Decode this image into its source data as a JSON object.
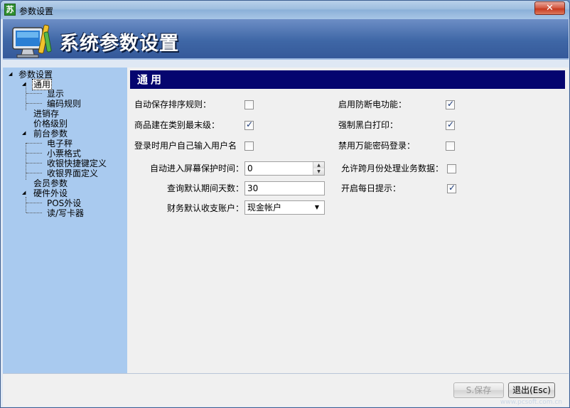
{
  "window": {
    "title": "参数设置",
    "app_icon_text": "苏",
    "close_label": "✕"
  },
  "banner": {
    "title": "系统参数设置",
    "logo_icon": "computer-settings-icon"
  },
  "tree": {
    "root": "参数设置",
    "general": "通用",
    "display": "显示",
    "code_rules": "编码规则",
    "purchase_sales_stock": "进销存",
    "price_levels": "价格级别",
    "front_desk": "前台参数",
    "electronic_scale": "电子秤",
    "receipt_format": "小票格式",
    "cashier_shortcuts": "收银快捷键定义",
    "cashier_ui": "收银界面定义",
    "member": "会员参数",
    "hardware": "硬件外设",
    "pos_peripherals": "POS外设",
    "card_reader": "读/写卡器"
  },
  "section": {
    "title": "通用"
  },
  "settings": {
    "auto_save_sort": {
      "label": "自动保存排序规则：",
      "checked": false
    },
    "power_off_protection": {
      "label": "启用防断电功能：",
      "checked": true
    },
    "goods_lowest_category": {
      "label": "商品建在类别最末级：",
      "checked": true
    },
    "force_bw_print": {
      "label": "强制黑白打印：",
      "checked": true
    },
    "login_enter_username": {
      "label": "登录时用户自己输入用户名",
      "checked": false
    },
    "disable_master_password": {
      "label": "禁用万能密码登录：",
      "checked": false
    },
    "screensaver_time": {
      "label": "自动进入屏幕保护时间：",
      "value": "0"
    },
    "cross_month": {
      "label": "允许跨月份处理业务数据：",
      "checked": false
    },
    "query_default_days": {
      "label": "查询默认期间天数：",
      "value": "30"
    },
    "daily_tips": {
      "label": "开启每日提示：",
      "checked": true
    },
    "finance_account": {
      "label": "财务默认收支账户：",
      "value": "现金帐户"
    }
  },
  "footer": {
    "save_label": "S.保存",
    "exit_label": "退出(Esc)"
  },
  "watermark": "www.pcsoft.com.cn"
}
